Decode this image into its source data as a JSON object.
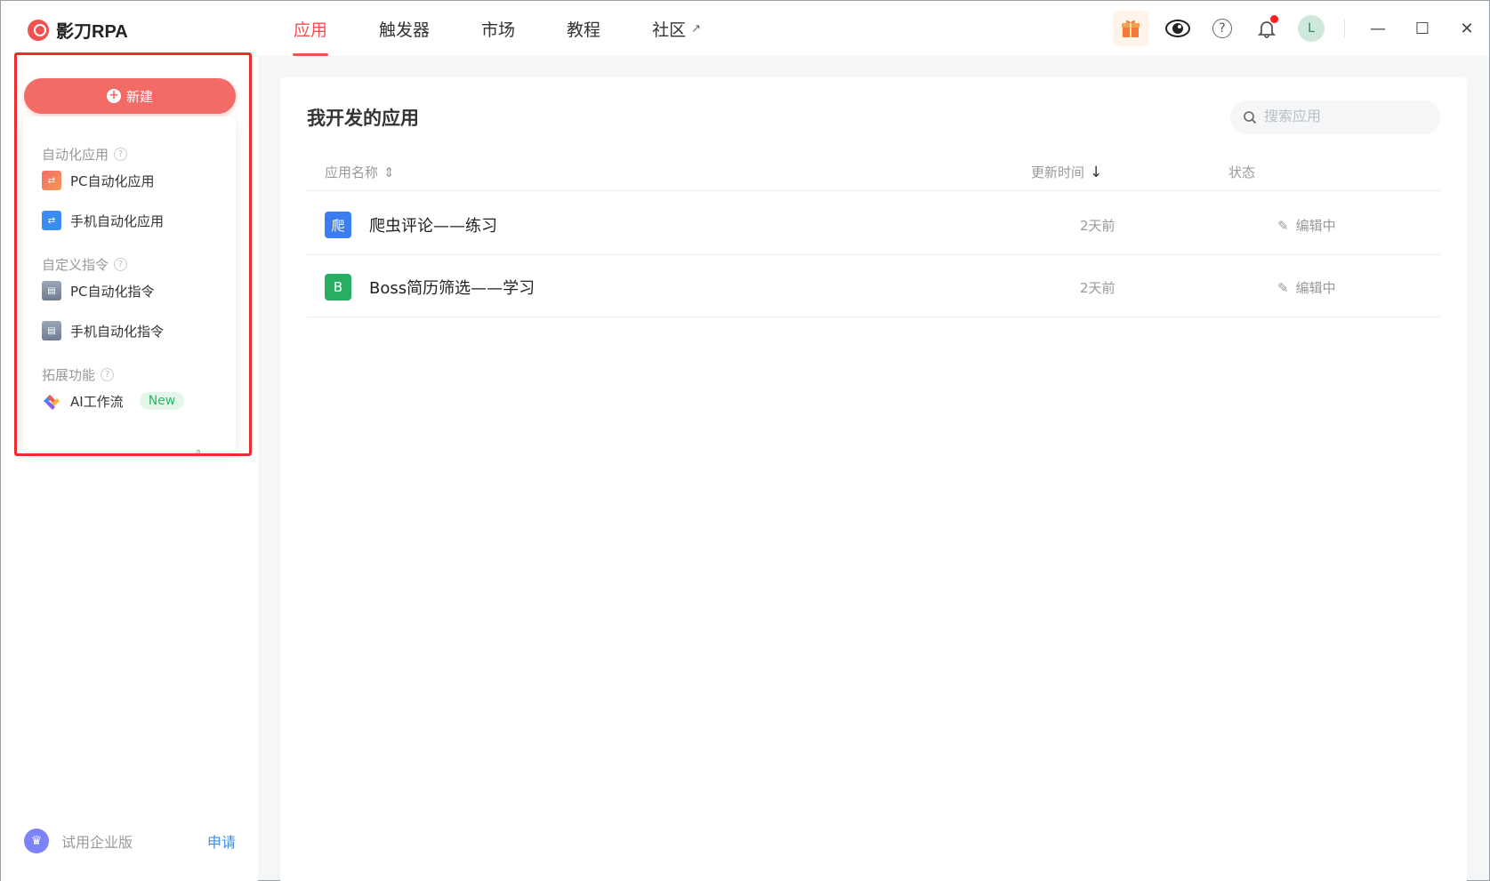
{
  "app": {
    "logo_text": "影刀RPA"
  },
  "nav": {
    "tabs": [
      {
        "label": "应用",
        "active": true
      },
      {
        "label": "触发器",
        "active": false
      },
      {
        "label": "市场",
        "active": false
      },
      {
        "label": "教程",
        "active": false
      },
      {
        "label": "社区",
        "active": false,
        "external": true
      }
    ]
  },
  "toolbar": {
    "avatar_letter": "L",
    "help_glyph": "?"
  },
  "sidebar": {
    "new_button": "新建",
    "sections": [
      {
        "title": "自动化应用",
        "items": [
          {
            "label": "PC自动化应用",
            "icon": "pc-app-icon"
          },
          {
            "label": "手机自动化应用",
            "icon": "mobile-app-icon"
          }
        ]
      },
      {
        "title": "自定义指令",
        "items": [
          {
            "label": "PC自动化指令",
            "icon": "pc-command-icon"
          },
          {
            "label": "手机自动化指令",
            "icon": "mobile-command-icon"
          }
        ]
      },
      {
        "title": "拓展功能",
        "items": [
          {
            "label": "AI工作流",
            "icon": "ai-workflow-icon",
            "badge": "New"
          }
        ]
      }
    ],
    "trial": {
      "text": "试用企业版",
      "action": "申请"
    }
  },
  "main": {
    "title": "我开发的应用",
    "search_placeholder": "搜索应用",
    "columns": {
      "name": "应用名称",
      "updated": "更新时间",
      "status": "状态"
    },
    "rows": [
      {
        "icon_char": "爬",
        "icon_color": "#3b7ef0",
        "name": "爬虫评论——练习",
        "updated": "2天前",
        "status": "编辑中"
      },
      {
        "icon_char": "B",
        "icon_color": "#27ae60",
        "name": "Boss简历筛选——学习",
        "updated": "2天前",
        "status": "编辑中"
      }
    ]
  },
  "colors": {
    "accent": "#f0524f",
    "new_button": "#f36b67",
    "link": "#3b8cf0",
    "highlight_frame": "#f02b2b"
  }
}
